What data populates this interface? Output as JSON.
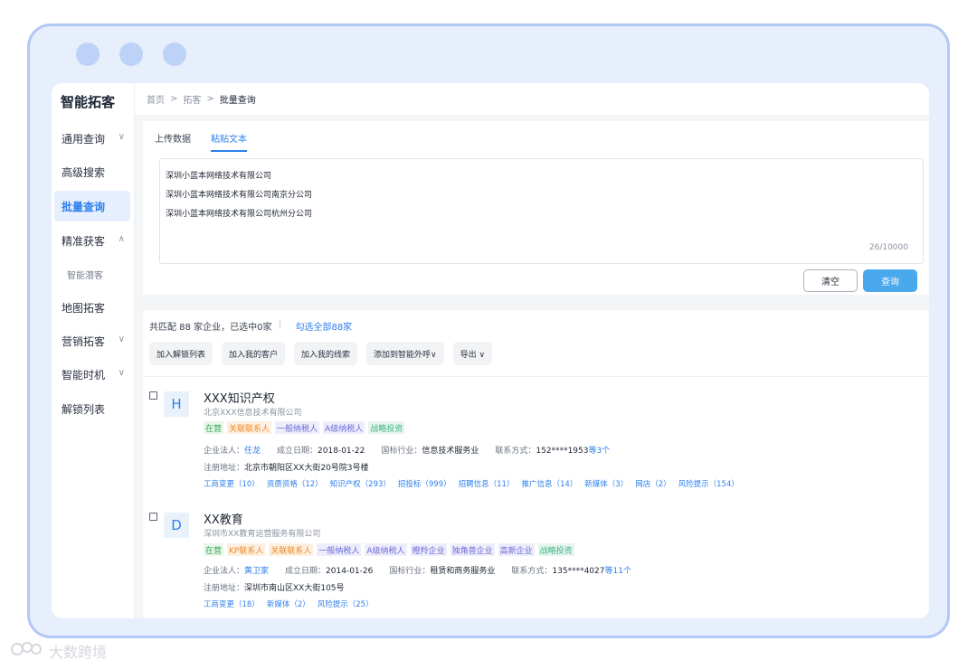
{
  "sidebar": {
    "brand": "智能拓客",
    "items": [
      {
        "label": "通用查询",
        "caret": "∨"
      },
      {
        "label": "高级搜索",
        "caret": ""
      },
      {
        "label": "批量查询",
        "caret": ""
      },
      {
        "label": "精准获客",
        "caret": "∧"
      },
      {
        "label": "智能潜客",
        "caret": ""
      },
      {
        "label": "地图拓客",
        "caret": ""
      },
      {
        "label": "营销拓客",
        "caret": "∨"
      },
      {
        "label": "智能时机",
        "caret": "∨"
      },
      {
        "label": "解锁列表",
        "caret": ""
      }
    ]
  },
  "breadcrumb": {
    "home": "首页",
    "parent": "拓客",
    "current": "批量查询",
    "sep": ">"
  },
  "tabs": [
    "上传数据",
    "粘贴文本"
  ],
  "textarea": {
    "lines": [
      "深圳小蓝本网络技术有限公司",
      "深圳小蓝本网络技术有限公司南京分公司",
      "深圳小蓝本网络技术有限公司杭州分公司"
    ],
    "counter": "26/10000"
  },
  "buttons": {
    "clear": "清空",
    "query": "查询"
  },
  "summary": {
    "text": "共匹配 88 家企业，已选中0家",
    "select_all": "勾选全部88家"
  },
  "actions": [
    "加入解锁列表",
    "加入我的客户",
    "加入我的线索",
    "添加到智能外呼∨",
    "导出 ∨"
  ],
  "companies": [
    {
      "avatar": "H",
      "name": "XXX知识产权",
      "legal_name": "北京XXX信息技术有限公司",
      "tags": [
        {
          "text": "在营",
          "color": "#3aa655",
          "bg": "#e9f6ec"
        },
        {
          "text": "关联联系人",
          "color": "#f08a24",
          "bg": "#fdf0e2"
        },
        {
          "text": "一般纳税人",
          "color": "#6d6bd8",
          "bg": "#eeedfb"
        },
        {
          "text": "A级纳税人",
          "color": "#6d6bd8",
          "bg": "#eeedfb"
        },
        {
          "text": "战略投资",
          "color": "#43b38a",
          "bg": "#e6f6ef"
        }
      ],
      "legal_rep_label": "企业法人：",
      "legal_rep": "任龙",
      "founded_label": "成立日期：",
      "founded": "2018-01-22",
      "industry_label": "国标行业：",
      "industry": "信息技术服务业",
      "contact_label": "联系方式：",
      "contact": "152****1953",
      "contact_more": "等3个",
      "address_label": "注册地址：",
      "address": "北京市朝阳区XX大街20号院3号楼",
      "links": [
        "工商变更（10）",
        "资质资格（12）",
        "知识产权（293）",
        "招投标（999）",
        "招聘信息（11）",
        "推广信息（14）",
        "新媒体（3）",
        "网店（2）",
        "风险提示（154）"
      ]
    },
    {
      "avatar": "D",
      "name": "XX教育",
      "legal_name": "深圳市XX教育运营服务有限公司",
      "tags": [
        {
          "text": "在营",
          "color": "#3aa655",
          "bg": "#e9f6ec"
        },
        {
          "text": "KP联系人",
          "color": "#f08a24",
          "bg": "#fdf0e2"
        },
        {
          "text": "关联联系人",
          "color": "#f08a24",
          "bg": "#fdf0e2"
        },
        {
          "text": "一般纳税人",
          "color": "#6d6bd8",
          "bg": "#eeedfb"
        },
        {
          "text": "A级纳税人",
          "color": "#6d6bd8",
          "bg": "#eeedfb"
        },
        {
          "text": "瞪羚企业",
          "color": "#6d6bd8",
          "bg": "#eeedfb"
        },
        {
          "text": "独角兽企业",
          "color": "#6d6bd8",
          "bg": "#eeedfb"
        },
        {
          "text": "高新企业",
          "color": "#6d6bd8",
          "bg": "#eeedfb"
        },
        {
          "text": "战略投资",
          "color": "#43b38a",
          "bg": "#e6f6ef"
        }
      ],
      "legal_rep_label": "企业法人：",
      "legal_rep": "黄卫家",
      "founded_label": "成立日期：",
      "founded": "2014-01-26",
      "industry_label": "国标行业：",
      "industry": "租赁和商务服务业",
      "contact_label": "联系方式：",
      "contact": "135****4027",
      "contact_more": "等11个",
      "address_label": "注册地址：",
      "address": "深圳市南山区XX大街105号",
      "links": [
        "工商变更（18）",
        "新媒体（2）",
        "风险提示（25）"
      ]
    }
  ],
  "watermark": "大数跨境",
  "colors": {
    "accent": "#2f80ed",
    "query_button": "#4aa8ec",
    "frame": "#e7eefc"
  }
}
